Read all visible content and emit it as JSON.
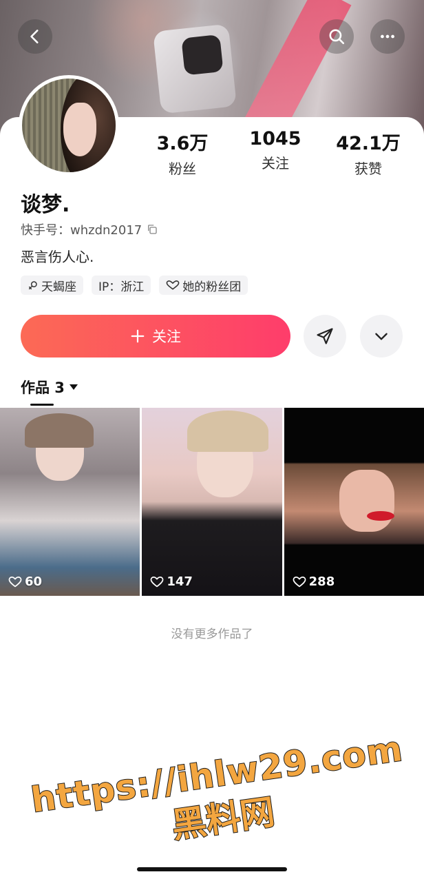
{
  "header": {
    "back_icon": "chevron-left-icon",
    "search_icon": "search-icon",
    "more_icon": "more-horizontal-icon"
  },
  "profile": {
    "name": "谈梦.",
    "kuaishou_id": "快手号：whzdn2017",
    "bio": "恶言伤人心.",
    "stats": [
      {
        "value": "3.6万",
        "label": "粉丝"
      },
      {
        "value": "1045",
        "label": "关注"
      },
      {
        "value": "42.1万",
        "label": "获赞"
      }
    ],
    "tags": [
      {
        "icon": "female-icon",
        "text": "天蝎座"
      },
      {
        "icon": "",
        "text": "IP：浙江"
      },
      {
        "icon": "heart-outline-icon",
        "text": "她的粉丝团"
      }
    ]
  },
  "actions": {
    "follow_label": "关注",
    "follow_color_start": "#fc6a55",
    "follow_color_end": "#fe3d6b"
  },
  "works": {
    "tab_label": "作品 3",
    "items": [
      {
        "likes": "60"
      },
      {
        "likes": "147"
      },
      {
        "likes": "288"
      }
    ],
    "no_more_text": "没有更多作品了"
  },
  "watermark": {
    "url": "https://ihlw29.com",
    "site": "黑料网",
    "color": "#f3a640"
  }
}
